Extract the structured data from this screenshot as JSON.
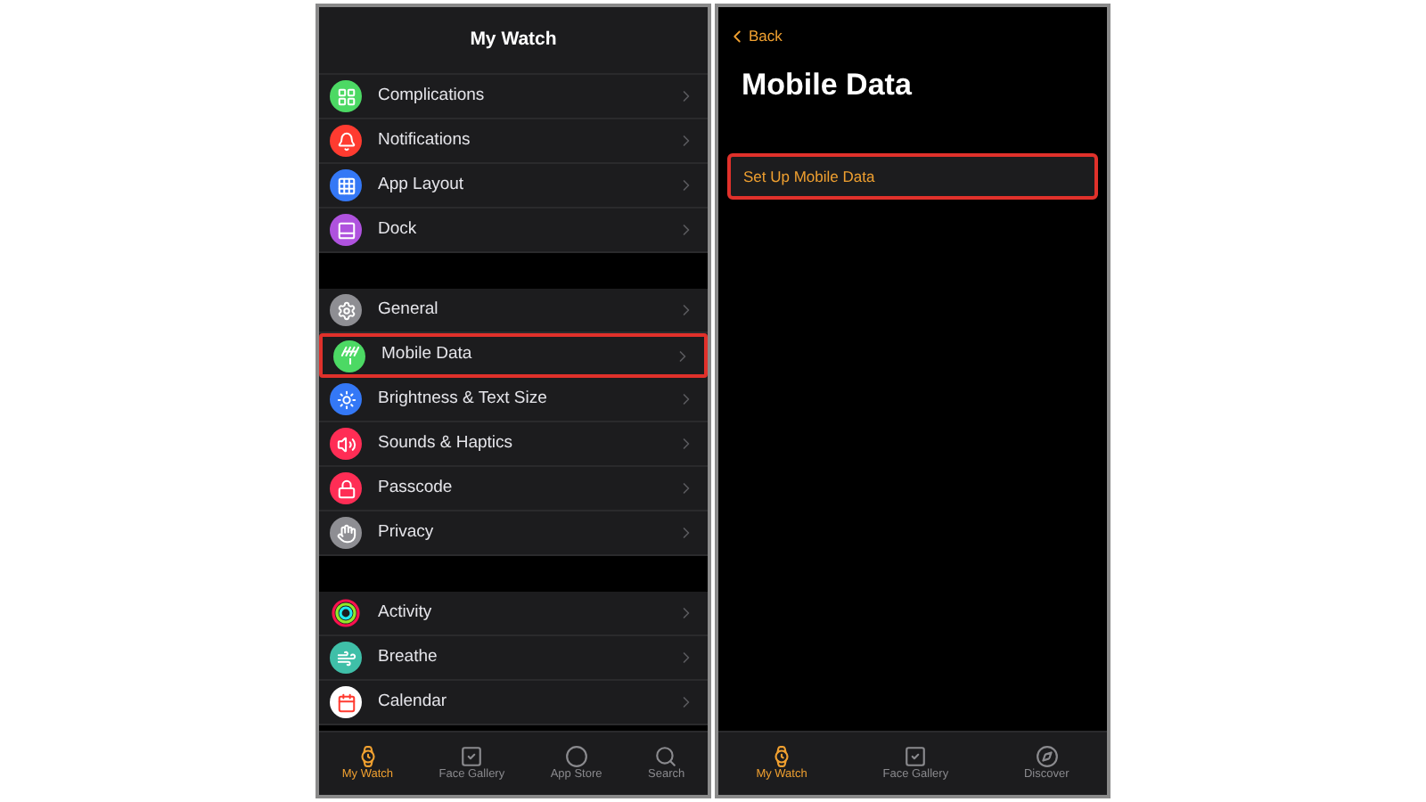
{
  "left_screen": {
    "title": "My Watch",
    "groups": [
      [
        {
          "label": "Complications",
          "color": "#4cd964",
          "highlighted": false
        },
        {
          "label": "Notifications",
          "color": "#ff3b30",
          "highlighted": false
        },
        {
          "label": "App Layout",
          "color": "#3478f6",
          "highlighted": false
        },
        {
          "label": "Dock",
          "color": "#af52de",
          "highlighted": false
        }
      ],
      [
        {
          "label": "General",
          "color": "#8e8e93",
          "highlighted": false
        },
        {
          "label": "Mobile Data",
          "color": "#4cd964",
          "highlighted": true
        },
        {
          "label": "Brightness & Text Size",
          "color": "#3478f6",
          "highlighted": false
        },
        {
          "label": "Sounds & Haptics",
          "color": "#ff2d55",
          "highlighted": false
        },
        {
          "label": "Passcode",
          "color": "#ff2d55",
          "highlighted": false
        },
        {
          "label": "Privacy",
          "color": "#8e8e93",
          "highlighted": false
        }
      ],
      [
        {
          "label": "Activity",
          "highlighted": false
        },
        {
          "label": "Breathe",
          "color": "#3fbfa8",
          "highlighted": false
        },
        {
          "label": "Calendar",
          "color": "#ffffff",
          "highlighted": false
        }
      ]
    ],
    "tab_bar": [
      {
        "label": "My Watch",
        "selected": true
      },
      {
        "label": "Face Gallery",
        "selected": false
      },
      {
        "label": "App Store",
        "selected": false
      },
      {
        "label": "Search",
        "selected": false
      }
    ]
  },
  "right_screen": {
    "back": "Back",
    "title": "Mobile Data",
    "action": {
      "label": "Set Up Mobile Data",
      "highlighted": true
    },
    "tab_bar": [
      {
        "label": "My Watch",
        "selected": true
      },
      {
        "label": "Face Gallery",
        "selected": false
      },
      {
        "label": "Discover",
        "selected": false
      }
    ]
  }
}
